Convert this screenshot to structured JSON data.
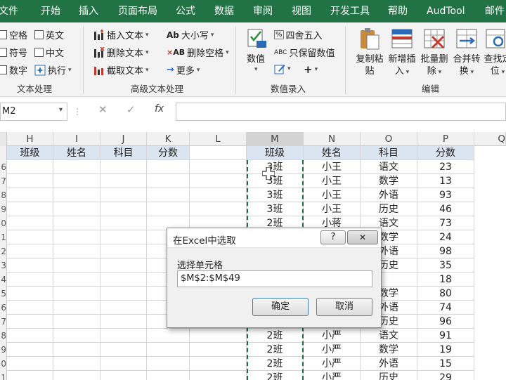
{
  "ribbon_tabs": [
    "文件",
    "开始",
    "插入",
    "页面布局",
    "公式",
    "数据",
    "审阅",
    "视图",
    "开发工具",
    "帮助",
    "AudTool",
    "邮件"
  ],
  "ribbon": {
    "col1": [
      "空格",
      "符号",
      "数字"
    ],
    "col2": [
      "英文",
      "中文",
      "执行"
    ],
    "group1": "文本处理",
    "col3": [
      "插入文本",
      "删除文本",
      "截取文本"
    ],
    "col4": [
      "大小写",
      "删除空格",
      "更多"
    ],
    "group2": "高级文本处理",
    "numeric": "数值",
    "round": "四舍五入",
    "keep_value": "只保留数值",
    "group3": "数值录入",
    "big_buttons": [
      {
        "l1": "复制粘",
        "l2": "贴"
      },
      {
        "l1": "新增插",
        "l2": "入"
      },
      {
        "l1": "批量删",
        "l2": "除"
      },
      {
        "l1": "合并转",
        "l2": "换"
      },
      {
        "l1": "查找定",
        "l2": "位"
      }
    ],
    "group4": "编辑"
  },
  "formula_bar": {
    "name_box": "M2",
    "fx": "fx",
    "cancel": "✕",
    "confirm": "✓"
  },
  "columns": [
    "H",
    "I",
    "J",
    "K",
    "L",
    "M",
    "N",
    "O",
    "P",
    "Q"
  ],
  "row_numbers": [
    "6",
    "7",
    "8",
    "9",
    "0",
    "1",
    "2",
    "3",
    "4",
    "5",
    "6",
    "7",
    "8",
    "9",
    "0",
    "1"
  ],
  "left_headers": [
    "班级",
    "姓名",
    "科目",
    "分数"
  ],
  "right_headers": [
    "班级",
    "姓名",
    "科目",
    "分数"
  ],
  "rows": [
    [
      "3班",
      "小王",
      "语文",
      "23"
    ],
    [
      "3班",
      "小王",
      "数学",
      "13"
    ],
    [
      "3班",
      "小王",
      "外语",
      "93"
    ],
    [
      "3班",
      "小王",
      "历史",
      "46"
    ],
    [
      "2班",
      "小蒋",
      "语文",
      "73"
    ],
    [
      "",
      "",
      "数学",
      "24"
    ],
    [
      "",
      "",
      "外语",
      "98"
    ],
    [
      "",
      "",
      "历史",
      "35"
    ],
    [
      "",
      "",
      "",
      "18"
    ],
    [
      "",
      "",
      "数学",
      "80"
    ],
    [
      "",
      "",
      "外语",
      "74"
    ],
    [
      "",
      "",
      "历史",
      "96"
    ],
    [
      "2班",
      "小严",
      "语文",
      "91"
    ],
    [
      "2班",
      "小严",
      "数学",
      "19"
    ],
    [
      "2班",
      "小严",
      "外语",
      "15"
    ],
    [
      "2班",
      "小严",
      "历史",
      "29"
    ]
  ],
  "dialog": {
    "title": "在Excel中选取",
    "help": "?",
    "close": "✕",
    "label": "选择单元格",
    "value": "$M$2:$M$49",
    "ok": "确定",
    "cancel": "取消"
  }
}
